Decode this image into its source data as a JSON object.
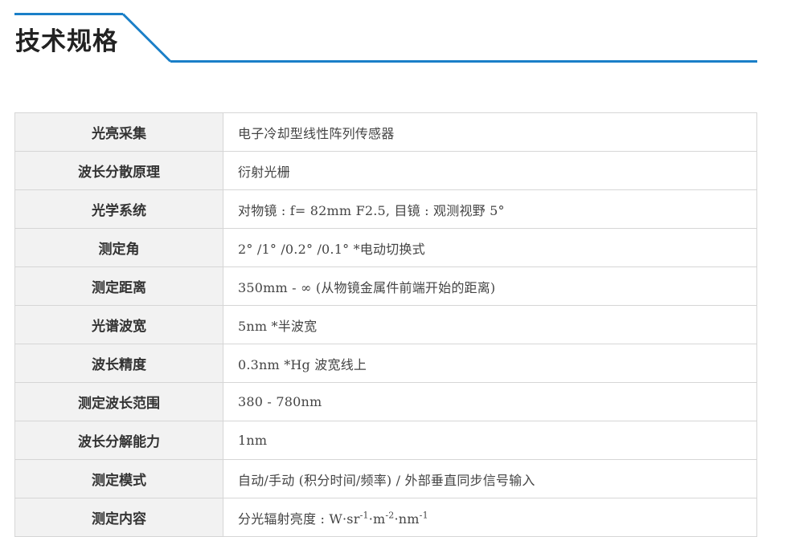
{
  "header": {
    "title": "技术规格",
    "accent_color": "#1a7fc8"
  },
  "specs": [
    {
      "label": "光亮采集",
      "value": "电子冷却型线性阵列传感器"
    },
    {
      "label": "波长分散原理",
      "value": "衍射光栅"
    },
    {
      "label": "光学系统",
      "value": "对物镜 : f= 82mm F2.5, 目镜 : 观测视野 5°"
    },
    {
      "label": "测定角",
      "value": "2° /1° /0.2° /0.1°  *电动切换式"
    },
    {
      "label": "测定距离",
      "value": "350mm  -  ∞ (从物镜金属件前端开始的距离)"
    },
    {
      "label": "光谱波宽",
      "value": "5nm *半波宽"
    },
    {
      "label": "波长精度",
      "value": "0.3nm *Hg 波宽线上"
    },
    {
      "label": "测定波长范围",
      "value": "380  -  780nm"
    },
    {
      "label": "波长分解能力",
      "value": "1nm"
    },
    {
      "label": "测定模式",
      "value": "自动/手动 (积分时间/频率) / 外部垂直同步信号输入"
    },
    {
      "label": "测定内容",
      "value_prefix": "分光辐射亮度 : W·sr",
      "exp1": "-1",
      "unit2": "·m",
      "exp2": "-2",
      "unit3": "·nm",
      "exp3": "-1"
    }
  ]
}
